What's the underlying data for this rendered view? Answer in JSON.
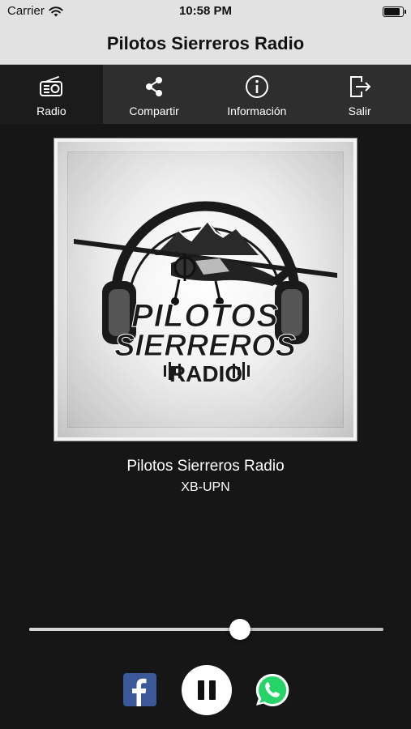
{
  "status_bar": {
    "carrier": "Carrier",
    "time": "10:58 PM",
    "icons": [
      "wifi-icon",
      "battery-icon"
    ]
  },
  "nav": {
    "title": "Pilotos Sierreros Radio"
  },
  "tabs": [
    {
      "label": "Radio",
      "icon": "radio-icon",
      "active": true
    },
    {
      "label": "Compartir",
      "icon": "share-icon",
      "active": false
    },
    {
      "label": "Información",
      "icon": "info-icon",
      "active": false
    },
    {
      "label": "Salir",
      "icon": "exit-icon",
      "active": false
    }
  ],
  "cover": {
    "logo_line1": "PILOTOS",
    "logo_line2": "SIERREROS",
    "logo_line3": "RADIO"
  },
  "now_playing": {
    "station": "Pilotos Sierreros Radio",
    "subtitle": "XB-UPN"
  },
  "volume": {
    "level": 0.595
  },
  "controls": {
    "facebook_icon": "facebook-icon",
    "pause_icon": "pause-icon",
    "whatsapp_icon": "whatsapp-icon"
  },
  "colors": {
    "background": "#161616",
    "tabbar": "#2e2e2e",
    "tab_active": "#1b1b1b",
    "header": "#e2e2e2",
    "facebook": "#3b5998",
    "whatsapp": "#25d366"
  }
}
